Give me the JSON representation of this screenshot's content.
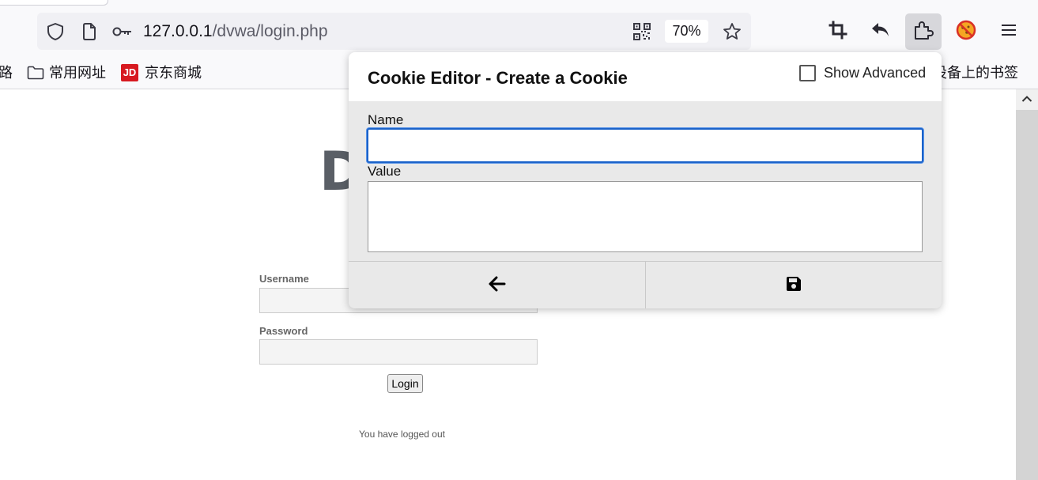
{
  "browser": {
    "url_host": "127.0.0.1",
    "url_path": "/dvwa/login.php",
    "zoom": "70%"
  },
  "bookmarks": {
    "items": [
      {
        "label": "路"
      },
      {
        "label": "常用网址",
        "icon": "folder-icon"
      },
      {
        "label": "京东商城",
        "icon": "jd-icon",
        "icon_text": "JD"
      },
      {
        "label": "设备上的书签"
      }
    ]
  },
  "page": {
    "logo_text": "D",
    "username_label": "Username",
    "password_label": "Password",
    "login_button": "Login",
    "status_message": "You have logged out"
  },
  "cookie_editor": {
    "title": "Cookie Editor - Create a Cookie",
    "show_advanced_label": "Show Advanced",
    "show_advanced_checked": false,
    "name_label": "Name",
    "name_value": "",
    "value_label": "Value",
    "value_value": "",
    "back_icon": "arrow-left-icon",
    "save_icon": "floppy-disk-icon"
  },
  "colors": {
    "focus_ring": "#1a62c9",
    "jd_red": "#d71920"
  }
}
